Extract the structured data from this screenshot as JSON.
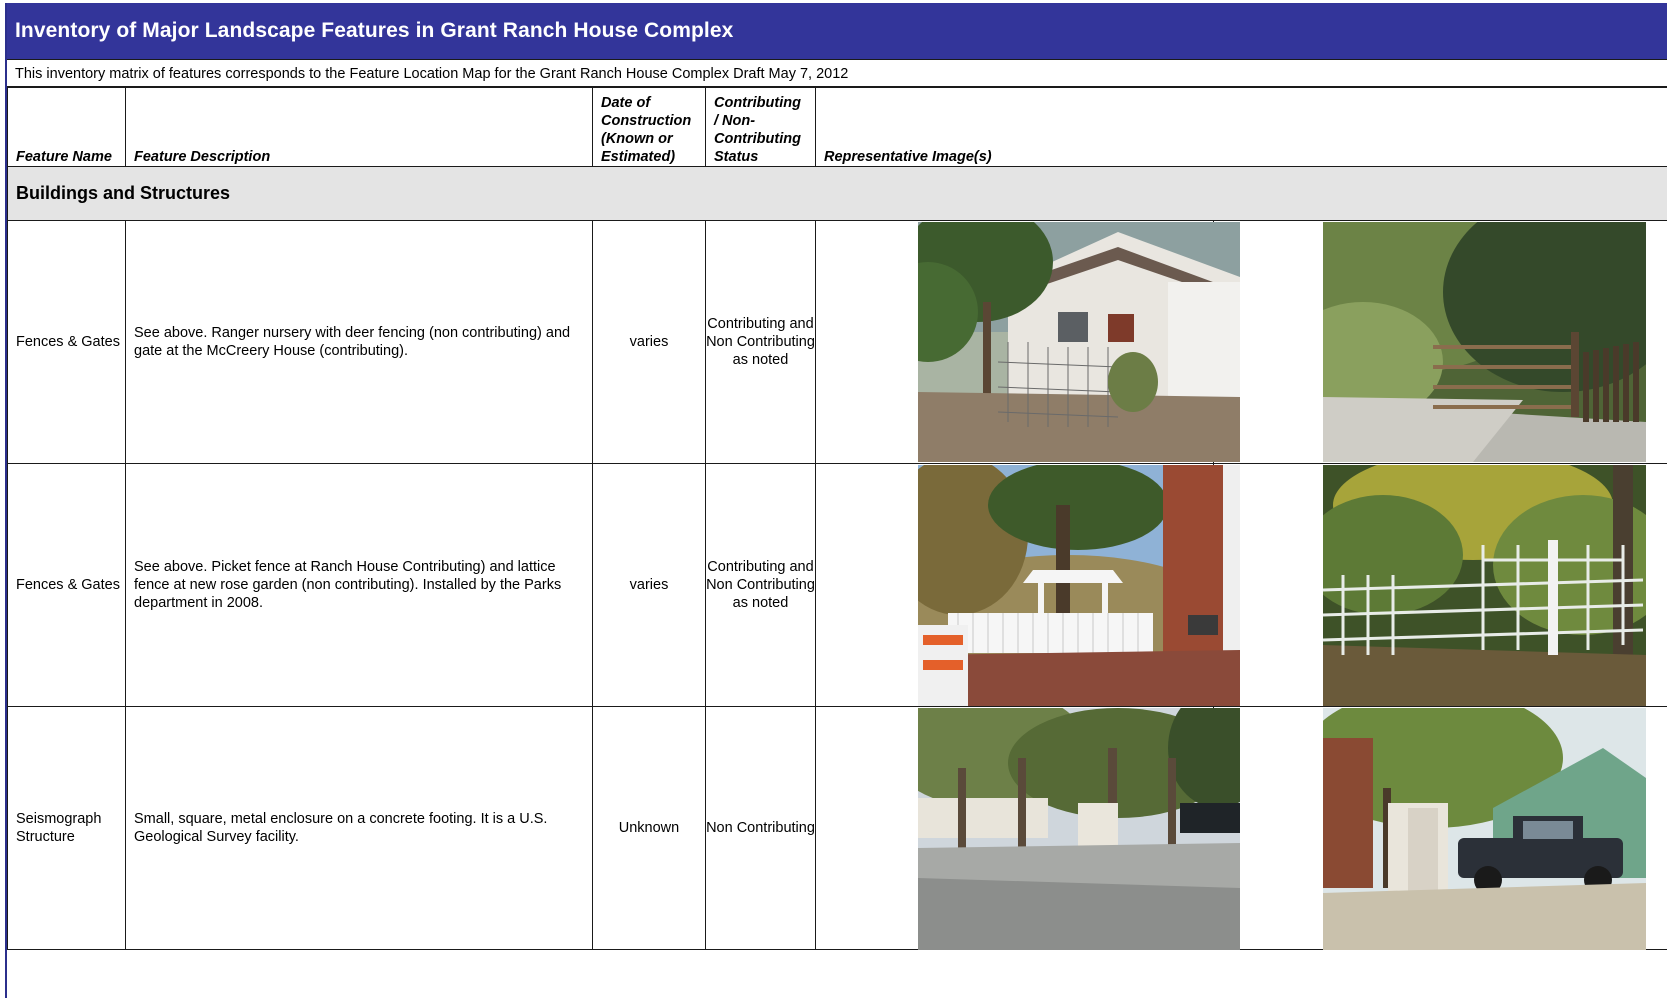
{
  "document": {
    "title": "Inventory of Major Landscape Features in Grant Ranch House Complex",
    "subtitle": "This inventory matrix of features corresponds to the Feature Location Map for the Grant Ranch House Complex  Draft May 7, 2012"
  },
  "columns": {
    "feature_name": "Feature Name",
    "feature_description": "Feature Description",
    "date_of_construction": "Date of Construction (Known or Estimated)",
    "status": "Contributing / Non-Contributing Status",
    "images": "Representative Image(s)"
  },
  "section": {
    "title": "Buildings and Structures"
  },
  "rows": [
    {
      "name": "Fences & Gates",
      "description": "See above. Ranger nursery with deer fencing (non contributing) and gate at the McCreery House (contributing).",
      "date": "varies",
      "status": "Contributing and Non Contributing as noted",
      "images": [
        "house-with-deer-fence-photo",
        "wooden-ranch-gate-photo"
      ]
    },
    {
      "name": "Fences & Gates",
      "description": "See above. Picket fence at Ranch House Contributing) and lattice fence at new rose garden (non contributing).  Installed by the Parks department in 2008.",
      "date": "varies",
      "status": "Contributing and Non Contributing as noted",
      "images": [
        "picket-fence-arbor-photo",
        "lattice-fence-photo"
      ]
    },
    {
      "name": "Seismograph Structure",
      "description": "Small, square, metal enclosure on a concrete footing.  It is a U.S. Geological Survey facility.",
      "date": "Unknown",
      "status": "Non Contributing",
      "images": [
        "seismograph-enclosure-photo",
        "enclosure-with-truck-photo"
      ]
    }
  ],
  "colors": {
    "title_bar": "#33359a",
    "section_band": "#e4e4e4",
    "rule": "#1a1a1a"
  }
}
